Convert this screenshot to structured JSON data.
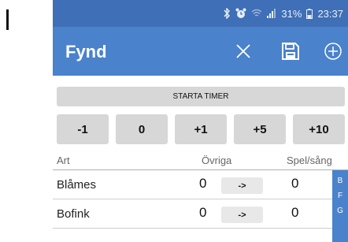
{
  "status_bar": {
    "battery": "31%",
    "time": "23:37"
  },
  "app_bar": {
    "title": "Fynd",
    "actions": [
      "close-icon",
      "save-icon",
      "add-circle-icon"
    ]
  },
  "timer_button": "STARTA TIMER",
  "step_buttons": [
    "-1",
    "0",
    "+1",
    "+5",
    "+10"
  ],
  "table_headers": {
    "art": "Art",
    "ovriga": "Övriga",
    "spel": "Spel/sång"
  },
  "species": [
    {
      "name": "Blåmes",
      "ovriga": "0",
      "arrow": "->",
      "spel": "0"
    },
    {
      "name": "Bofink",
      "ovriga": "0",
      "arrow": "->",
      "spel": "0"
    }
  ],
  "index_letters": [
    "B",
    "F",
    "G"
  ],
  "colors": {
    "status_bar": "#3f6fb6",
    "app_bar": "#4a82cc",
    "button_gray": "#d7d7d7"
  }
}
